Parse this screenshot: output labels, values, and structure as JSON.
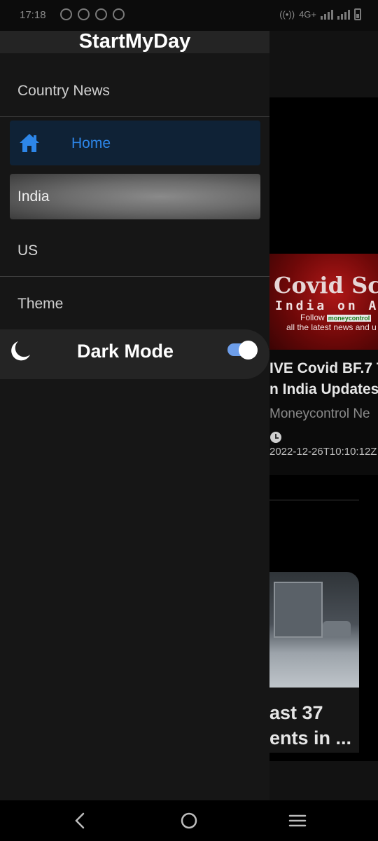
{
  "status_bar": {
    "time": "17:18",
    "network": "4G+"
  },
  "drawer": {
    "title": "StartMyDay",
    "section_country": "Country News",
    "items": [
      {
        "label": "Home",
        "icon": "home-icon",
        "selected": true
      },
      {
        "label": "India",
        "selected": false
      },
      {
        "label": "US",
        "selected": false
      }
    ],
    "section_theme": "Theme",
    "dark_mode": {
      "label": "Dark Mode",
      "icon": "moon-icon",
      "enabled": true
    }
  },
  "background_feed": {
    "article1": {
      "banner_line1": "Covid Sc",
      "banner_line2": "India on A",
      "banner_follow": "Follow",
      "banner_brand": "moneycontrol",
      "banner_line4": "all the latest news and u",
      "title_line1": "IVE Covid BF.7 T",
      "title_line2": "n India Updates",
      "source": "Moneycontrol Ne",
      "timestamp": "2022-12-26T10:10:12Z"
    },
    "article2": {
      "title_line1": "ast 37",
      "title_line2": "ents in ..."
    }
  },
  "colors": {
    "accent": "#2d86e8",
    "drawer_bg": "#161616",
    "selected_bg": "#0f2236",
    "toggle_on": "#6d9eea"
  }
}
